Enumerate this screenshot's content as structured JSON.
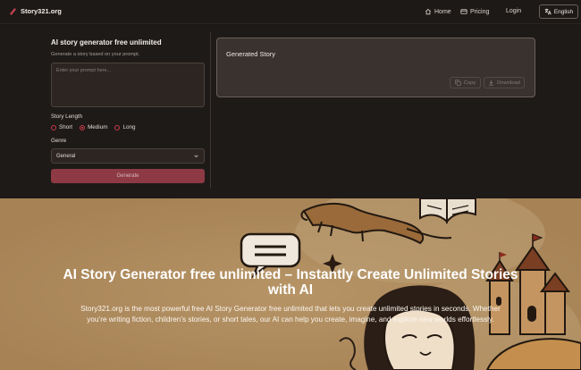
{
  "header": {
    "brand": "Story321.org",
    "nav": {
      "home": "Home",
      "pricing": "Pricing",
      "login": "Login"
    },
    "language": "English"
  },
  "form": {
    "title": "AI story generator free unlimited",
    "subtitle": "Generate a story based on your prompt.",
    "prompt_placeholder": "Enter your prompt here...",
    "length_label": "Story Length",
    "length_options": [
      "Short",
      "Medium",
      "Long"
    ],
    "length_selected": "Medium",
    "genre_label": "Genre",
    "genre_value": "General",
    "generate_label": "Generate"
  },
  "output": {
    "title": "Generated Story",
    "copy_label": "Copy",
    "download_label": "Download"
  },
  "hero": {
    "title": "AI Story Generator free unlimited – Instantly Create Unlimited Stories with AI",
    "description": "Story321.org is the most powerful free AI Story Generator free unlimited that lets you create unlimited stories in seconds. Whether you’re writing fiction, children’s stories, or short tales, our AI can help you create, imagine, and explore new worlds effortlessly."
  },
  "colors": {
    "accent": "#c83a4a",
    "hero_bg": "#ae8a5c",
    "page_bg": "#1e1a18"
  }
}
